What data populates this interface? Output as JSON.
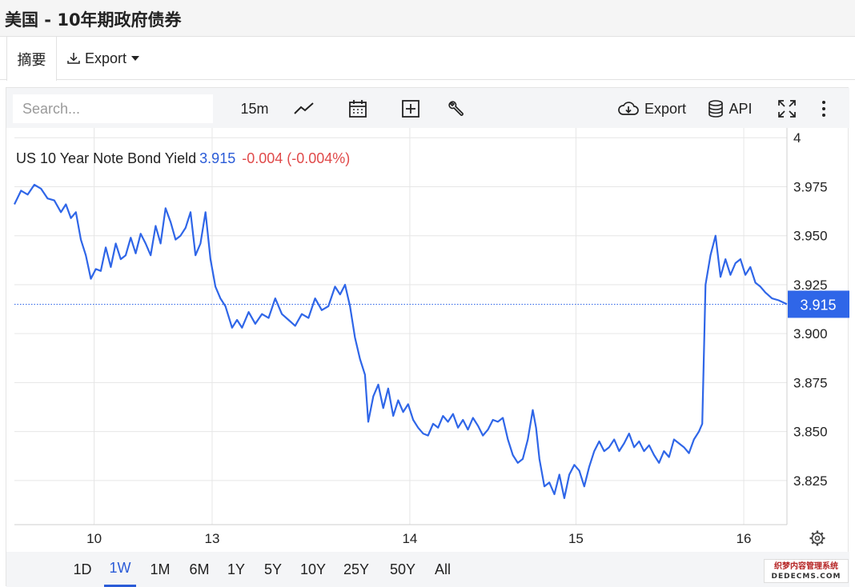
{
  "header": {
    "title": "美国 - 10年期政府债券"
  },
  "tabs": {
    "summary_label": "摘要",
    "export_label": "Export"
  },
  "toolbar": {
    "search_placeholder": "Search...",
    "interval_label": "15m",
    "export_label": "Export",
    "api_label": "API"
  },
  "legend": {
    "name": "US 10 Year Note Bond Yield",
    "value": "3.915",
    "change": "-0.004 (-0.004%)"
  },
  "ranges": [
    "1D",
    "1W",
    "1M",
    "6M",
    "1Y",
    "5Y",
    "10Y",
    "25Y",
    "50Y",
    "All"
  ],
  "active_range": "1W",
  "colors": {
    "line": "#2f66e8",
    "accent": "#2a5bd7",
    "negative": "#e04a4a",
    "price_tag": "#2f66e8"
  },
  "watermark": {
    "line1": "织梦内容管理系统",
    "line2": "DEDECMS.COM"
  },
  "chart_data": {
    "type": "line",
    "title": "",
    "xlabel": "",
    "ylabel": "",
    "x_ticks": [
      {
        "label": "10",
        "x": 2.5
      },
      {
        "label": "13",
        "x": 9.6
      },
      {
        "label": "14",
        "x": 21.5
      },
      {
        "label": "15",
        "x": 31.5
      },
      {
        "label": "16",
        "x": 41.6
      }
    ],
    "xlim": [
      -2.3,
      44.2
    ],
    "ylim": [
      3.8025,
      4.005
    ],
    "y_ticks": [
      "4",
      "3.975",
      "3.950",
      "3.925",
      "3.900",
      "3.875",
      "3.850",
      "3.825"
    ],
    "last_value": "3.915",
    "last_value_num": 3.915,
    "series": [
      {
        "values": [
          [
            -2.3,
            3.966
          ],
          [
            -1.9,
            3.973
          ],
          [
            -1.5,
            3.971
          ],
          [
            -1.1,
            3.976
          ],
          [
            -0.7,
            3.974
          ],
          [
            -0.3,
            3.969
          ],
          [
            0.1,
            3.968
          ],
          [
            0.5,
            3.962
          ],
          [
            0.8,
            3.966
          ],
          [
            1.1,
            3.959
          ],
          [
            1.4,
            3.962
          ],
          [
            1.7,
            3.948
          ],
          [
            2.0,
            3.94
          ],
          [
            2.3,
            3.928
          ],
          [
            2.6,
            3.933
          ],
          [
            2.9,
            3.932
          ],
          [
            3.2,
            3.944
          ],
          [
            3.5,
            3.934
          ],
          [
            3.8,
            3.946
          ],
          [
            4.1,
            3.938
          ],
          [
            4.4,
            3.94
          ],
          [
            4.7,
            3.949
          ],
          [
            5.0,
            3.941
          ],
          [
            5.3,
            3.951
          ],
          [
            5.6,
            3.946
          ],
          [
            5.9,
            3.94
          ],
          [
            6.2,
            3.955
          ],
          [
            6.5,
            3.946
          ],
          [
            6.8,
            3.964
          ],
          [
            7.1,
            3.957
          ],
          [
            7.4,
            3.948
          ],
          [
            7.7,
            3.95
          ],
          [
            8.0,
            3.954
          ],
          [
            8.3,
            3.962
          ],
          [
            8.6,
            3.94
          ],
          [
            8.9,
            3.946
          ],
          [
            9.2,
            3.962
          ],
          [
            9.5,
            3.938
          ],
          [
            9.8,
            3.924
          ],
          [
            10.1,
            3.918
          ],
          [
            10.4,
            3.914
          ],
          [
            10.8,
            3.903
          ],
          [
            11.1,
            3.907
          ],
          [
            11.4,
            3.903
          ],
          [
            11.8,
            3.911
          ],
          [
            12.2,
            3.905
          ],
          [
            12.6,
            3.91
          ],
          [
            13.0,
            3.908
          ],
          [
            13.4,
            3.918
          ],
          [
            13.8,
            3.91
          ],
          [
            14.2,
            3.907
          ],
          [
            14.6,
            3.904
          ],
          [
            15.0,
            3.91
          ],
          [
            15.4,
            3.908
          ],
          [
            15.8,
            3.918
          ],
          [
            16.2,
            3.912
          ],
          [
            16.6,
            3.914
          ],
          [
            17.0,
            3.924
          ],
          [
            17.3,
            3.92
          ],
          [
            17.6,
            3.925
          ],
          [
            17.9,
            3.914
          ],
          [
            18.2,
            3.898
          ],
          [
            18.5,
            3.887
          ],
          [
            18.8,
            3.879
          ],
          [
            19.0,
            3.855
          ],
          [
            19.3,
            3.868
          ],
          [
            19.6,
            3.874
          ],
          [
            19.9,
            3.862
          ],
          [
            20.2,
            3.872
          ],
          [
            20.5,
            3.858
          ],
          [
            20.8,
            3.866
          ],
          [
            21.1,
            3.86
          ],
          [
            21.4,
            3.864
          ],
          [
            21.7,
            3.856
          ],
          [
            22.0,
            3.852
          ],
          [
            22.3,
            3.849
          ],
          [
            22.6,
            3.848
          ],
          [
            22.9,
            3.854
          ],
          [
            23.2,
            3.852
          ],
          [
            23.5,
            3.858
          ],
          [
            23.8,
            3.855
          ],
          [
            24.1,
            3.859
          ],
          [
            24.4,
            3.852
          ],
          [
            24.7,
            3.856
          ],
          [
            25.0,
            3.851
          ],
          [
            25.3,
            3.857
          ],
          [
            25.6,
            3.853
          ],
          [
            25.9,
            3.848
          ],
          [
            26.2,
            3.851
          ],
          [
            26.5,
            3.856
          ],
          [
            26.8,
            3.855
          ],
          [
            27.1,
            3.857
          ],
          [
            27.4,
            3.846
          ],
          [
            27.7,
            3.838
          ],
          [
            28.0,
            3.834
          ],
          [
            28.3,
            3.836
          ],
          [
            28.6,
            3.846
          ],
          [
            28.9,
            3.861
          ],
          [
            29.1,
            3.852
          ],
          [
            29.3,
            3.836
          ],
          [
            29.6,
            3.822
          ],
          [
            29.9,
            3.824
          ],
          [
            30.2,
            3.818
          ],
          [
            30.5,
            3.828
          ],
          [
            30.8,
            3.816
          ],
          [
            31.1,
            3.828
          ],
          [
            31.4,
            3.833
          ],
          [
            31.7,
            3.83
          ],
          [
            32.0,
            3.822
          ],
          [
            32.3,
            3.832
          ],
          [
            32.6,
            3.84
          ],
          [
            32.9,
            3.845
          ],
          [
            33.2,
            3.84
          ],
          [
            33.5,
            3.842
          ],
          [
            33.8,
            3.846
          ],
          [
            34.1,
            3.84
          ],
          [
            34.4,
            3.844
          ],
          [
            34.7,
            3.849
          ],
          [
            35.0,
            3.842
          ],
          [
            35.3,
            3.845
          ],
          [
            35.6,
            3.84
          ],
          [
            35.9,
            3.843
          ],
          [
            36.2,
            3.838
          ],
          [
            36.5,
            3.834
          ],
          [
            36.8,
            3.84
          ],
          [
            37.1,
            3.837
          ],
          [
            37.4,
            3.846
          ],
          [
            37.7,
            3.844
          ],
          [
            38.0,
            3.842
          ],
          [
            38.3,
            3.839
          ],
          [
            38.6,
            3.846
          ],
          [
            38.9,
            3.85
          ],
          [
            39.1,
            3.854
          ],
          [
            39.3,
            3.925
          ],
          [
            39.6,
            3.94
          ],
          [
            39.9,
            3.95
          ],
          [
            40.2,
            3.929
          ],
          [
            40.5,
            3.938
          ],
          [
            40.8,
            3.93
          ],
          [
            41.1,
            3.936
          ],
          [
            41.4,
            3.938
          ],
          [
            41.7,
            3.93
          ],
          [
            42.0,
            3.934
          ],
          [
            42.3,
            3.926
          ],
          [
            42.6,
            3.924
          ],
          [
            42.9,
            3.921
          ],
          [
            43.3,
            3.918
          ],
          [
            43.7,
            3.917
          ],
          [
            44.2,
            3.915
          ]
        ]
      }
    ],
    "grid": true,
    "legend_position": "top-left"
  }
}
